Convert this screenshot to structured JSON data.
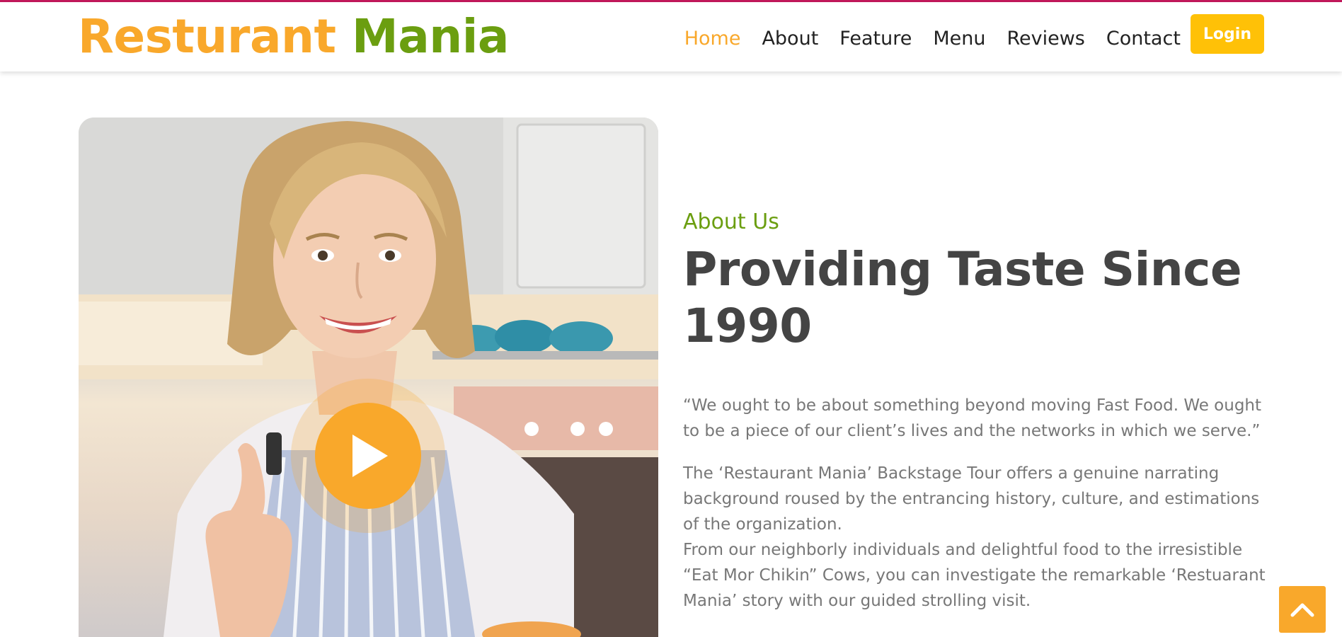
{
  "brand": {
    "name_part1": "Resturant",
    "name_part2": "Mania",
    "color_primary": "#f9a82b",
    "color_secondary": "#6b9e10"
  },
  "nav": {
    "items": [
      {
        "label": "Home",
        "active": true
      },
      {
        "label": "About",
        "active": false
      },
      {
        "label": "Feature",
        "active": false
      },
      {
        "label": "Menu",
        "active": false
      },
      {
        "label": "Reviews",
        "active": false
      },
      {
        "label": "Contact",
        "active": false
      }
    ],
    "login_label": "Login"
  },
  "hero_image": {
    "alt": "Smiling chef in apron giving thumbs up",
    "play_icon": "play-icon"
  },
  "about": {
    "label": "About Us",
    "title": "Providing Taste Since 1990",
    "quote": "“We ought to be about something beyond moving Fast Food. We ought to be a piece of our client’s lives and the networks in which we serve.”",
    "description1": "The ‘Restaurant Mania’ Backstage Tour offers a genuine narrating background roused by the entrancing history, culture, and estimations of the organization.",
    "description2": "From our neighborly individuals and delightful food to the irresistible “Eat Mor Chikin” Cows, you can investigate the remarkable ‘Restuarant Mania’ story with our guided strolling visit."
  },
  "scroll_top": {
    "icon": "chevron-up-icon"
  }
}
